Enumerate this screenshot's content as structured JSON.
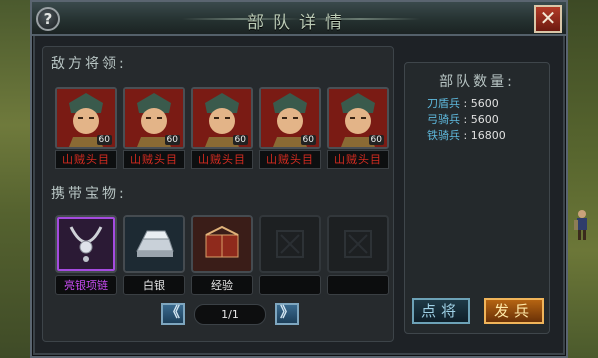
{
  "window": {
    "title": "部队详情"
  },
  "buttons": {
    "help": "?",
    "close": "✕",
    "prev": "《",
    "next": "》",
    "general": "点将",
    "send": "发兵"
  },
  "sections": {
    "enemy_generals": "敌方将领:",
    "treasures": "携带宝物:"
  },
  "generals": [
    {
      "name": "山贼头目",
      "level": "60"
    },
    {
      "name": "山贼头目",
      "level": "60"
    },
    {
      "name": "山贼头目",
      "level": "60"
    },
    {
      "name": "山贼头目",
      "level": "60"
    },
    {
      "name": "山贼头目",
      "level": "60"
    }
  ],
  "treasures": [
    {
      "name": "亮银项链",
      "color": "#c84bf2",
      "icon": "necklace-icon"
    },
    {
      "name": "白银",
      "color": "#e6e6e6",
      "icon": "silver-ingot-icon"
    },
    {
      "name": "经验",
      "color": "#e6e6e6",
      "icon": "experience-book-icon"
    },
    {
      "name": "",
      "icon": "empty-slot-icon"
    },
    {
      "name": "",
      "icon": "empty-slot-icon"
    }
  ],
  "pager": {
    "text": "1/1"
  },
  "troops": {
    "title": "部队数量:",
    "items": [
      {
        "label": "刀盾兵",
        "sep": ":",
        "count": "5600"
      },
      {
        "label": "弓骑兵",
        "sep": ":",
        "count": "5600"
      },
      {
        "label": "铁骑兵",
        "sep": ":",
        "count": "16800"
      }
    ]
  }
}
